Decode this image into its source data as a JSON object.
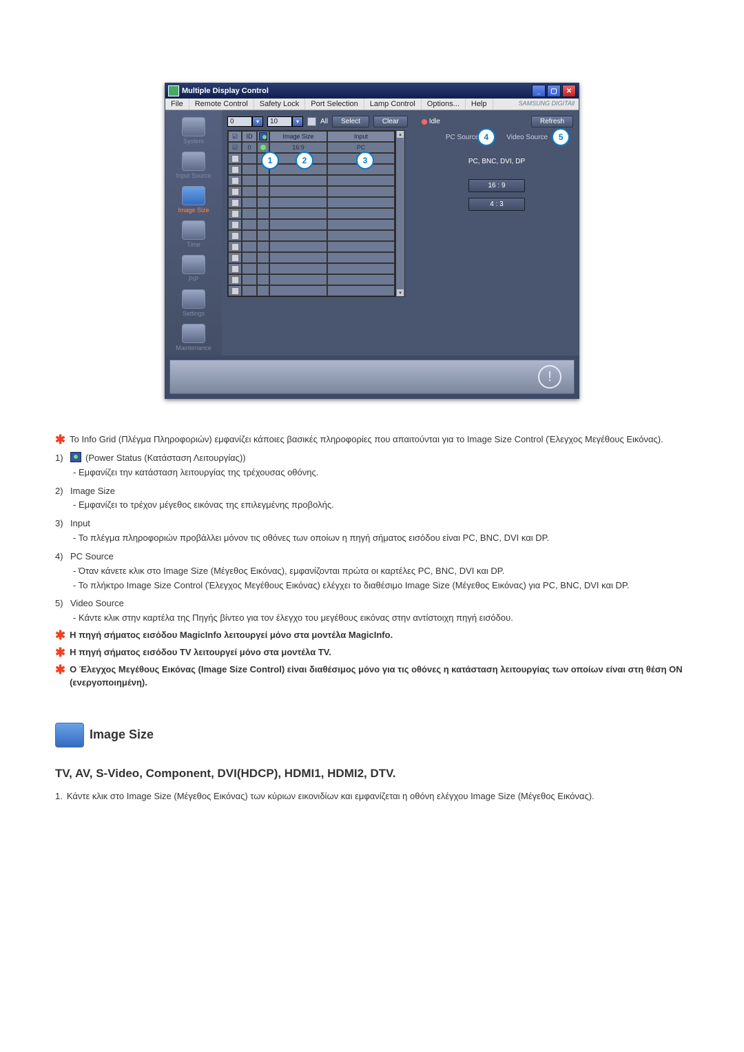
{
  "app": {
    "title": "Multiple Display Control",
    "menus": [
      "File",
      "Remote Control",
      "Safety Lock",
      "Port Selection",
      "Lamp Control",
      "Options...",
      "Help"
    ],
    "brand": "SAMSUNG DIGITAll"
  },
  "sidebar": {
    "items": [
      {
        "label": "System"
      },
      {
        "label": "Input Source"
      },
      {
        "label": "Image Size",
        "active": true
      },
      {
        "label": "Time"
      },
      {
        "label": "PIP"
      },
      {
        "label": "Settings"
      },
      {
        "label": "Maintenance"
      }
    ]
  },
  "toolbar": {
    "combo1": "0",
    "combo2": "10",
    "all_label": "All",
    "select": "Select",
    "clear": "Clear",
    "idle": "Idle",
    "refresh": "Refresh"
  },
  "tabs": {
    "pc": "PC Source",
    "video": "Video Source"
  },
  "info_grid": {
    "headers": {
      "checkbox": "",
      "id": "ID",
      "pwr": "",
      "imgsz": "Image Size",
      "input": "Input"
    },
    "row": {
      "id": "0",
      "imgsz": "16:9",
      "input": "PC"
    }
  },
  "right_panel": {
    "sources_title": "PC, BNC, DVI, DP",
    "opt_16_9": "16 : 9",
    "opt_4_3": "4 : 3"
  },
  "callouts": {
    "c1": "1",
    "c2": "2",
    "c3": "3",
    "c4": "4",
    "c5": "5"
  },
  "notes": {
    "intro": "Το Info Grid (Πλέγμα Πληροφοριών) εμφανίζει κάποιες βασικές πληροφορίες που απαιτούνται για το Image Size Control (Έλεγχος Μεγέθους Εικόνας).",
    "n1_label": "1)",
    "n1_title_after_icon": " (Power Status (Κατάσταση Λειτουργίας))",
    "n1_sub": "- Εμφανίζει την κατάσταση λειτουργίας της τρέχουσας οθόνης.",
    "n2_label": "2)",
    "n2_title": "Image Size",
    "n2_sub": "- Εμφανίζει το τρέχον μέγεθος εικόνας της επιλεγμένης προβολής.",
    "n3_label": "3)",
    "n3_title": "Input",
    "n3_sub": "- Το πλέγμα πληροφοριών προβάλλει μόνον τις οθόνες των οποίων η πηγή σήματος εισόδου είναι PC, BNC, DVI και DP.",
    "n4_label": "4)",
    "n4_title": "PC Source",
    "n4_sub1": "- Όταν κάνετε κλικ στο Image Size (Μέγεθος Εικόνας), εμφανίζονται πρώτα οι καρτέλες PC, BNC, DVI και DP.",
    "n4_sub2": "- Το πλήκτρο Image Size Control (Έλεγχος Μεγέθους Εικόνας) ελέγχει το διαθέσιμο Image Size (Μέγεθος Εικόνας) για PC, BNC, DVI και DP.",
    "n5_label": "5)",
    "n5_title": "Video Source",
    "n5_sub": "- Κάντε κλικ στην καρτέλα της Πηγής βίντεο για τον έλεγχο του μεγέθους εικόνας στην αντίστοιχη πηγή εισόδου.",
    "bold1": "Η πηγή σήματος εισόδου MagicInfo λειτουργεί μόνο στα μοντέλα MagicInfo.",
    "bold2": "Η πηγή σήματος εισόδου TV λειτουργεί μόνο στα μοντέλα TV.",
    "bold3": "Ο Έλεγχος Μεγέθους Εικόνας (Image Size Control) είναι διαθέσιμος μόνο για τις οθόνες η κατάσταση λειτουργίας των οποίων είναι στη θέση ON (ενεργοποιημένη)."
  },
  "section": {
    "title": "Image Size",
    "subtitle": "TV, AV, S-Video, Component, DVI(HDCP), HDMI1, HDMI2, DTV.",
    "item1_num": "1.",
    "item1_text": "Κάντε κλικ στο Image Size (Μέγεθος Εικόνας) των κύριων εικονιδίων και εμφανίζεται η οθόνη ελέγχου Image Size (Μέγεθος Εικόνας)."
  }
}
